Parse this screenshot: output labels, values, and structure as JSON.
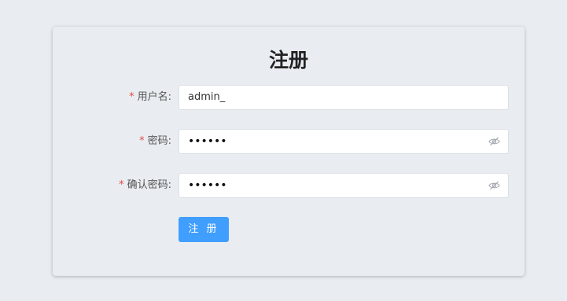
{
  "form": {
    "title": "注册",
    "username": {
      "required_mark": "*",
      "label": "用户名:",
      "value": "admin_"
    },
    "password": {
      "required_mark": "*",
      "label": "密码:",
      "value": "••••••"
    },
    "confirm_password": {
      "required_mark": "*",
      "label": "确认密码:",
      "value": "••••••"
    },
    "submit_label": "注 册"
  },
  "colors": {
    "background": "#e9edf1",
    "primary": "#409eff",
    "required": "#e34a4a"
  },
  "icons": [
    "eye-off-icon"
  ]
}
